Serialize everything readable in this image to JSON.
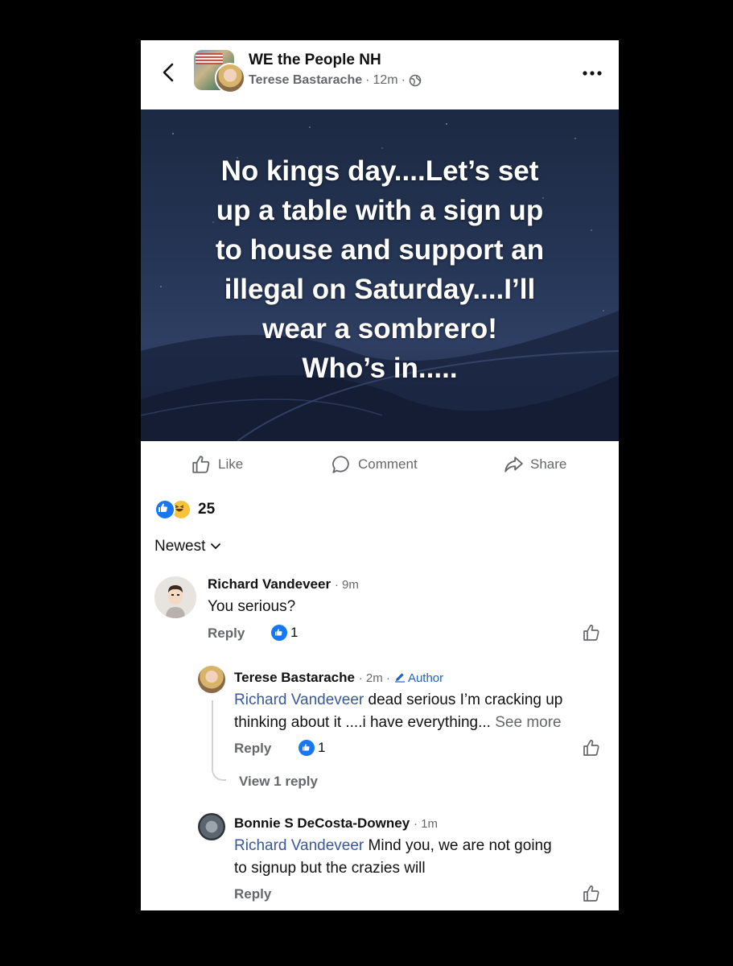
{
  "header": {
    "group_name": "WE the People NH",
    "author": "Terese Bastarache",
    "separator": "·",
    "time": "12m",
    "privacy_icon": "globe-icon",
    "back_icon": "chevron-left-icon",
    "more_icon": "more-horizontal-icon"
  },
  "post": {
    "lines": [
      "No kings day....Let’s set",
      "up a table with a sign up",
      "to house and support an",
      "illegal on Saturday....I’ll",
      "wear a sombrero!",
      "Who’s in....."
    ]
  },
  "actions": {
    "like": "Like",
    "comment": "Comment",
    "share": "Share"
  },
  "reactions": {
    "count": "25"
  },
  "sort": {
    "label": "Newest"
  },
  "comments": [
    {
      "name": "Richard Vandeveer",
      "time": "· 9m",
      "text": "You serious?",
      "reply": "Reply",
      "likes": "1"
    },
    {
      "name": "Terese Bastarache",
      "time": "· 2m ·",
      "author_tag": "Author",
      "mention": "Richard Vandeveer",
      "text_line1": " dead serious I’m cracking up",
      "text_line2": "thinking about it ....i have everything...",
      "see_more": " See more",
      "reply": "Reply",
      "likes": "1",
      "view_replies": "View 1 reply"
    },
    {
      "name": "Bonnie S DeCosta-Downey",
      "time": "· 1m",
      "mention": "Richard Vandeveer",
      "text_line1": " Mind you, we are not going",
      "text_line2": "to signup but the crazies will",
      "reply": "Reply"
    }
  ],
  "colors": {
    "brand_blue": "#1877f2",
    "mention": "#385898",
    "muted": "#65676b",
    "post_bg": "#253555"
  }
}
